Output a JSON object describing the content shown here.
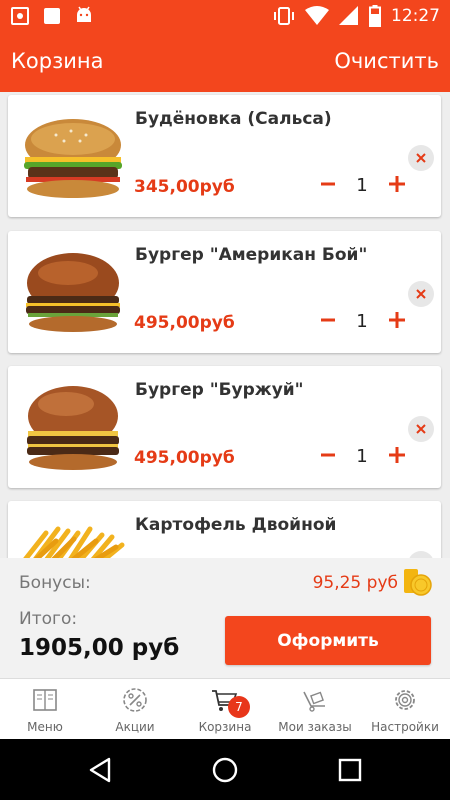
{
  "status_bar": {
    "time": "12:27",
    "icons_left": [
      "screenshot-icon",
      "notification-icon",
      "android-icon"
    ],
    "icons_right": [
      "vibrate-icon",
      "wifi-icon",
      "signal-icon",
      "battery-icon"
    ]
  },
  "app_bar": {
    "title": "Корзина",
    "clear_label": "Очистить"
  },
  "cart_items": [
    {
      "name": "Будёновка (Сальса)",
      "price": "345,00руб",
      "quantity": "1"
    },
    {
      "name": "Бургер \"Американ Бой\"",
      "price": "495,00руб",
      "quantity": "1"
    },
    {
      "name": "Бургер \"Буржуй\"",
      "price": "495,00руб",
      "quantity": "1"
    },
    {
      "name": "Картофель Двойной",
      "price": "",
      "quantity": ""
    }
  ],
  "summary": {
    "bonus_label": "Бонусы:",
    "bonus_value": "95,25 руб",
    "total_label": "Итого:",
    "total_value": "1905,00 руб",
    "checkout_label": "Оформить"
  },
  "bottom_nav": {
    "items": [
      {
        "label": "Меню",
        "icon": "menu-book-icon"
      },
      {
        "label": "Акции",
        "icon": "percent-badge-icon"
      },
      {
        "label": "Корзина",
        "icon": "cart-icon"
      },
      {
        "label": "Мои заказы",
        "icon": "delivery-cart-icon"
      },
      {
        "label": "Настройки",
        "icon": "gear-icon"
      }
    ],
    "cart_badge": "7",
    "active_index": 2
  },
  "colors": {
    "brand": "#f3461d",
    "price": "#e53b16",
    "badge": "#e8361a"
  }
}
